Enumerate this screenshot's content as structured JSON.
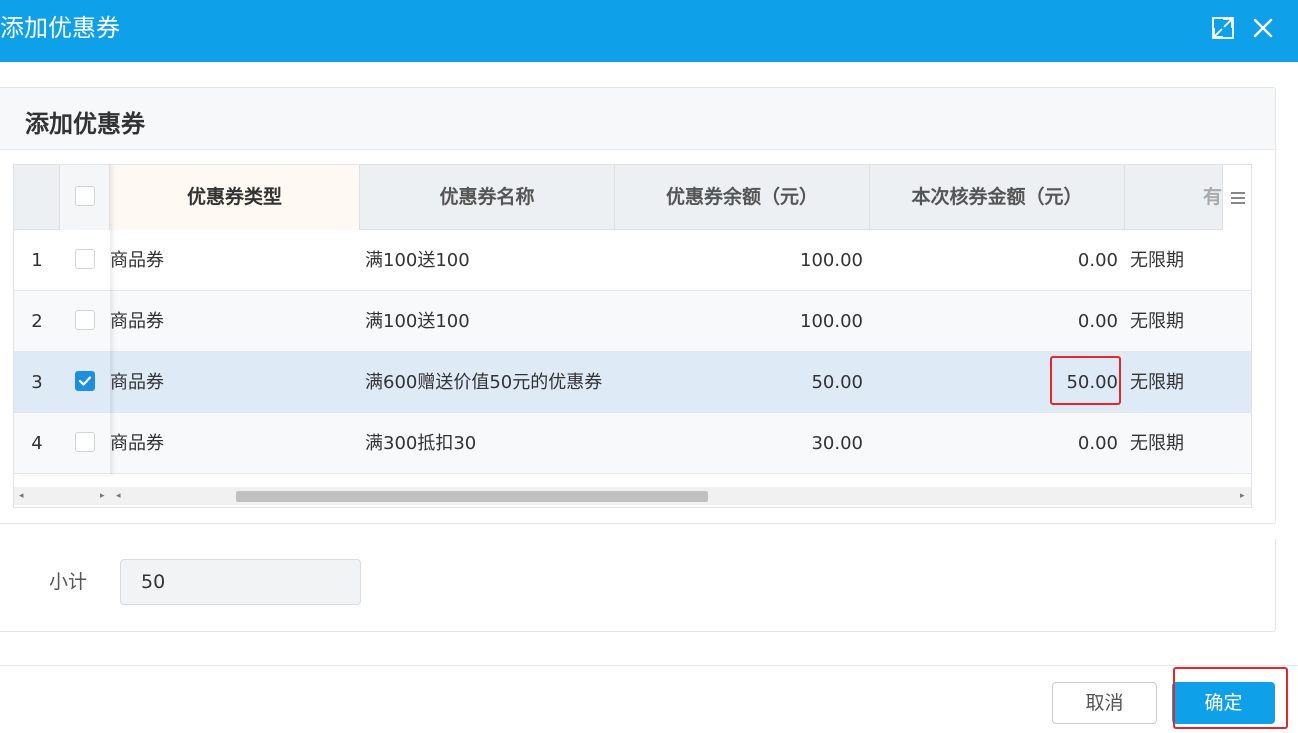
{
  "window": {
    "title": "添加优惠券"
  },
  "panel": {
    "title": "添加优惠券"
  },
  "grid": {
    "columns": [
      "优惠券类型",
      "优惠券名称",
      "优惠券余额（元）",
      "本次核券金额（元）",
      "有"
    ],
    "rows": [
      {
        "index": "1",
        "checked": false,
        "type": "商品券",
        "name": "满100送100",
        "balance": "100.00",
        "amount": "0.00",
        "validity": "无限期"
      },
      {
        "index": "2",
        "checked": false,
        "type": "商品券",
        "name": "满100送100",
        "balance": "100.00",
        "amount": "0.00",
        "validity": "无限期"
      },
      {
        "index": "3",
        "checked": true,
        "type": "商品券",
        "name": "满600赠送价值50元的优惠券",
        "balance": "50.00",
        "amount": "50.00",
        "validity": "无限期"
      },
      {
        "index": "4",
        "checked": false,
        "type": "商品券",
        "name": "满300抵扣30",
        "balance": "30.00",
        "amount": "0.00",
        "validity": "无限期"
      }
    ]
  },
  "subtotal": {
    "label": "小计",
    "value": "50"
  },
  "footer": {
    "cancel_label": "取消",
    "ok_label": "确定"
  },
  "colors": {
    "titlebar": "#0ea0e8",
    "primary": "#0ea0e8",
    "highlight": "#e5262b",
    "selected_row": "#dfeaf7"
  }
}
